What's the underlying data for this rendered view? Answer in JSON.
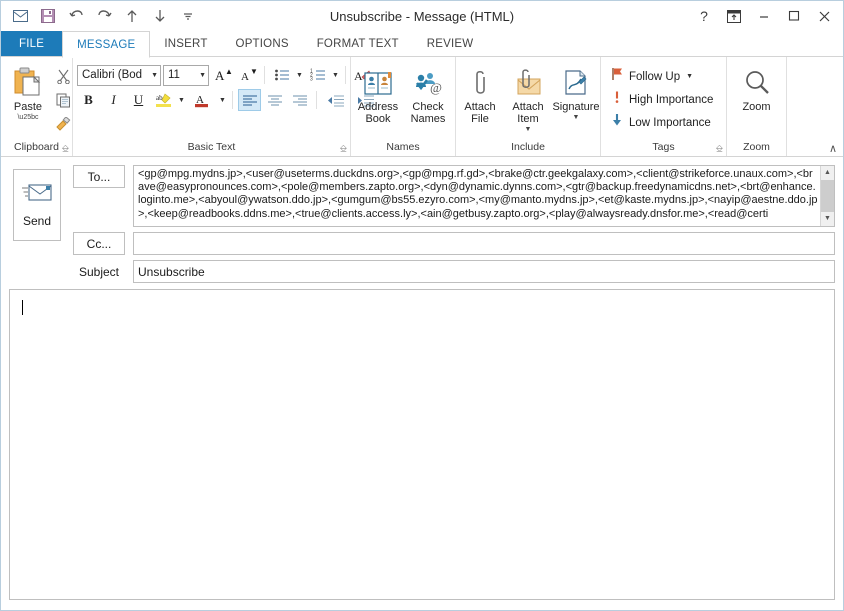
{
  "window": {
    "title": "Unsubscribe - Message (HTML)",
    "accent": "#1d7bb9"
  },
  "quick_access": [
    {
      "name": "envelope-icon",
      "label": "Message"
    },
    {
      "name": "save-icon",
      "label": "Save"
    },
    {
      "name": "undo-icon",
      "label": "Undo"
    },
    {
      "name": "redo-icon",
      "label": "Redo"
    },
    {
      "name": "previous-item-icon",
      "label": "Previous Item"
    },
    {
      "name": "next-item-icon",
      "label": "Next Item"
    },
    {
      "name": "customize-qat-icon",
      "label": "Customize Quick Access Toolbar"
    }
  ],
  "window_controls": {
    "help": "?",
    "ribbon_options": "ribbon-display-options",
    "minimize": "–",
    "maximize": "□",
    "close": "✕"
  },
  "tabs": [
    {
      "label": "FILE",
      "active": false,
      "file": true
    },
    {
      "label": "MESSAGE",
      "active": true,
      "file": false
    },
    {
      "label": "INSERT",
      "active": false,
      "file": false
    },
    {
      "label": "OPTIONS",
      "active": false,
      "file": false
    },
    {
      "label": "FORMAT TEXT",
      "active": false,
      "file": false
    },
    {
      "label": "REVIEW",
      "active": false,
      "file": false
    }
  ],
  "ribbon": {
    "clipboard": {
      "label": "Clipboard",
      "paste_label": "Paste",
      "cut_label": "Cut",
      "copy_label": "Copy",
      "format_painter_label": "Format Painter",
      "dialog_launcher": "⬌"
    },
    "basic_text": {
      "label": "Basic Text",
      "font_name": "Calibri (Bod",
      "font_size": "11",
      "grow_font": "A",
      "shrink_font": "A",
      "bullets": "bullets",
      "numbering": "numbering",
      "clear_formatting": "Clear All Formatting",
      "bold": "B",
      "italic": "I",
      "underline": "U",
      "highlight": "ab",
      "font_color": "A",
      "align_left": "Align Left",
      "align_center": "Center",
      "align_right": "Align Right",
      "decrease_indent": "Decrease Indent",
      "increase_indent": "Increase Indent",
      "dialog_launcher": "⬌"
    },
    "names": {
      "label": "Names",
      "address_book": "Address\nBook",
      "address_book_l1": "Address",
      "address_book_l2": "Book",
      "check_names_l1": "Check",
      "check_names_l2": "Names"
    },
    "include": {
      "label": "Include",
      "attach_file_l1": "Attach",
      "attach_file_l2": "File",
      "attach_item_l1": "Attach",
      "attach_item_l2": "Item",
      "signature": "Signature"
    },
    "tags": {
      "label": "Tags",
      "dialog_launcher": "⬌",
      "items": [
        {
          "label": "Follow Up",
          "icon": "flag-icon",
          "caret": true
        },
        {
          "label": "High Importance",
          "icon": "exclamation-icon",
          "caret": false
        },
        {
          "label": "Low Importance",
          "icon": "down-arrow-icon",
          "caret": false
        }
      ]
    },
    "zoom": {
      "label": "Zoom",
      "button_label": "Zoom"
    },
    "collapse_chevron": "∧"
  },
  "compose": {
    "send_label": "Send",
    "to_label": "To...",
    "cc_label": "Cc...",
    "subject_label": "Subject",
    "to_value": "<gp@mpg.mydns.jp>,<user@useterms.duckdns.org>,<gp@mpg.rf.gd>,<brake@ctr.geekgalaxy.com>,<client@strikeforce.unaux.com>,<brave@easypronounces.com>,<pole@members.zapto.org>,<dyn@dynamic.dynns.com>,<gtr@backup.freedynamicdns.net>,<brt@enhance.loginto.me>,<abyoul@ywatson.ddo.jp>,<gumgum@bs55.ezyro.com>,<my@manto.mydns.jp>,<et@kaste.mydns.jp>,<nayip@aestne.ddo.jp>,<keep@readbooks.ddns.me>,<true@clients.access.ly>,<ain@getbusy.zapto.org>,<play@alwaysready.dnsfor.me>,<read@certi",
    "cc_value": "",
    "subject_value": "Unsubscribe",
    "body_value": ""
  }
}
